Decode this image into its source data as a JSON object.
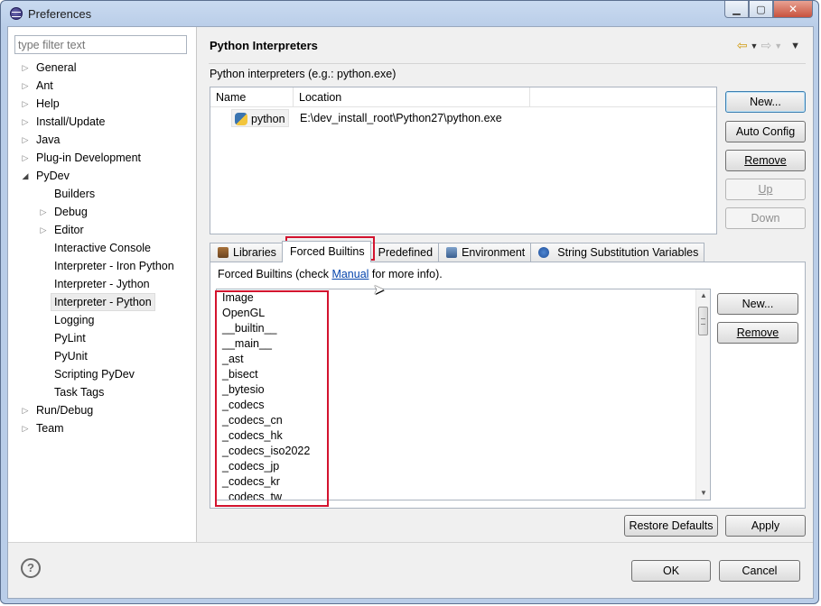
{
  "window": {
    "title": "Preferences",
    "minimize_glyph": "▁",
    "maximize_glyph": "▢",
    "close_glyph": "✕"
  },
  "filter": {
    "placeholder": "type filter text"
  },
  "tree": {
    "general": "General",
    "ant": "Ant",
    "help": "Help",
    "install_update": "Install/Update",
    "java": "Java",
    "plugin_development": "Plug-in Development",
    "pydev": "PyDev",
    "builders": "Builders",
    "debug": "Debug",
    "editor": "Editor",
    "interactive_console": "Interactive Console",
    "interpreter_iron_python": "Interpreter - Iron Python",
    "interpreter_jython": "Interpreter - Jython",
    "interpreter_python": "Interpreter - Python",
    "logging": "Logging",
    "pylint": "PyLint",
    "pyunit": "PyUnit",
    "scripting_pydev": "Scripting PyDev",
    "task_tags": "Task Tags",
    "run_debug": "Run/Debug",
    "team": "Team"
  },
  "page": {
    "title": "Python Interpreters",
    "description": "Python interpreters (e.g.: python.exe)"
  },
  "interpreters": {
    "columns": {
      "name": "Name",
      "location": "Location"
    },
    "rows": [
      {
        "name": "python",
        "location": "E:\\dev_install_root\\Python27\\python.exe"
      }
    ]
  },
  "interp_buttons": {
    "new": "New...",
    "auto_config": "Auto Config",
    "remove": "Remove",
    "up": "Up",
    "down": "Down"
  },
  "tabs": {
    "libraries": "Libraries",
    "forced_builtins": "Forced Builtins",
    "predefined": "Predefined",
    "environment": "Environment",
    "string_substitution": "String Substitution Variables"
  },
  "forced_builtins": {
    "desc_prefix": "Forced Builtins (check ",
    "link": "Manual",
    "desc_suffix": " for more info).",
    "items": [
      "Image",
      "OpenGL",
      "__builtin__",
      "__main__",
      "_ast",
      "_bisect",
      "_bytesio",
      "_codecs",
      "_codecs_cn",
      "_codecs_hk",
      "_codecs_iso2022",
      "_codecs_jp",
      "_codecs_kr",
      "_codecs_tw"
    ],
    "new": "New...",
    "remove": "Remove"
  },
  "footer": {
    "restore_defaults": "Restore Defaults",
    "apply": "Apply",
    "ok": "OK",
    "cancel": "Cancel",
    "help_glyph": "?"
  },
  "colors": {
    "highlight": "#d3132e",
    "link": "#0645ad"
  }
}
